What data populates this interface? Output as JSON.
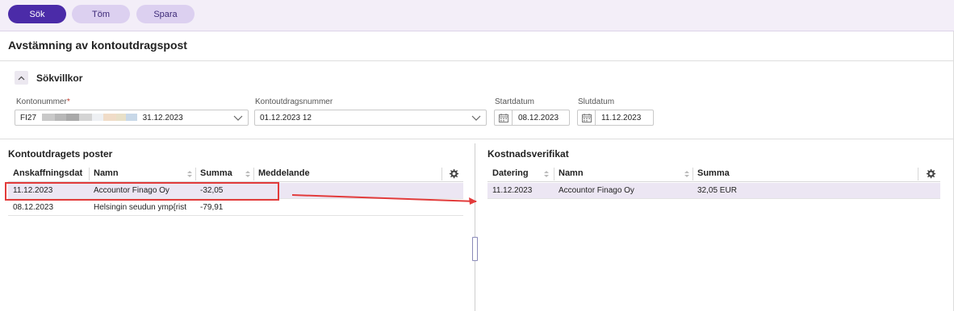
{
  "toolbar": {
    "search_label": "Sök",
    "clear_label": "Töm",
    "save_label": "Spara"
  },
  "page": {
    "title": "Avstämning av kontoutdragspost"
  },
  "search_criteria": {
    "section_label": "Sökvillkor",
    "account_number": {
      "label": "Kontonummer",
      "required_mark": "*",
      "value_prefix": "FI27",
      "value_date": "31.12.2023"
    },
    "statement_number": {
      "label": "Kontoutdragsnummer",
      "value": "01.12.2023 12"
    },
    "start_date": {
      "label": "Startdatum",
      "value": "08.12.2023"
    },
    "end_date": {
      "label": "Slutdatum",
      "value": "11.12.2023"
    }
  },
  "statement_entries": {
    "title": "Kontoutdragets poster",
    "columns": [
      "Anskaffningsdat",
      "Namn",
      "Summa",
      "Meddelande"
    ],
    "rows": [
      {
        "date": "11.12.2023",
        "name": "Accountor Finago Oy",
        "amount": "-32,05",
        "message": ""
      },
      {
        "date": "08.12.2023",
        "name": "Helsingin seudun ymp{rist",
        "amount": "-79,91",
        "message": ""
      }
    ]
  },
  "expense_vouchers": {
    "title": "Kostnadsverifikat",
    "columns": [
      "Datering",
      "Namn",
      "Summa"
    ],
    "rows": [
      {
        "date": "11.12.2023",
        "name": "Accountor Finago Oy",
        "amount": "32,05 EUR"
      }
    ]
  },
  "colors": {
    "accent": "#4b2ba8",
    "accent_light": "#dcd0f0",
    "toolbar_bg": "#f3eef8",
    "selected_row": "#ece6f3",
    "annotation_red": "#e23b3b"
  },
  "icons": {
    "collapse": "chevron-up-icon",
    "dropdown": "chevron-down-icon",
    "calendar": "calendar-icon",
    "settings": "gear-icon",
    "sort": "sort-icon",
    "annotation_arrow": "arrow-right-icon"
  }
}
